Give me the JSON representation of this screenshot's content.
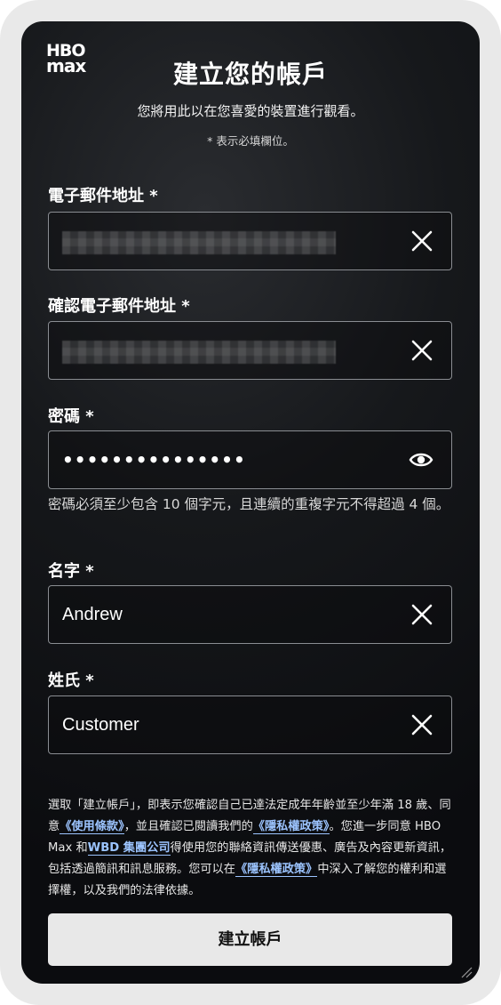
{
  "brand": {
    "logo_top": "HBO",
    "logo_bottom": "max"
  },
  "header": {
    "title": "建立您的帳戶",
    "subtitle": "您將用此以在您喜愛的裝置進行觀看。",
    "required_note": "* 表示必填欄位。"
  },
  "fields": {
    "email": {
      "label": "電子郵件地址 *",
      "value": "",
      "clear_icon": "close-icon"
    },
    "confirm_email": {
      "label": "確認電子郵件地址 *",
      "value": "",
      "clear_icon": "close-icon"
    },
    "password": {
      "label": "密碼 *",
      "value": "•••••••••••••••",
      "toggle_icon": "eye-icon",
      "hint": "密碼必須至少包含 10 個字元，且連續的重複字元不得超過 4 個。"
    },
    "first_name": {
      "label": "名字 *",
      "value": "Andrew",
      "clear_icon": "close-icon"
    },
    "last_name": {
      "label": "姓氏 *",
      "value": "Customer",
      "clear_icon": "close-icon"
    }
  },
  "legal": {
    "part1": "選取「建立帳戶」，即表示您確認自己已達法定成年年齡並至少年滿 18 歲、同意",
    "terms_link": "《使用條款》",
    "part2": "，並且確認已閱讀我們的",
    "privacy_link": "《隱私權政策》",
    "part3": "。您進一步同意 HBO Max 和",
    "wbd_link": "WBD 集團公司",
    "part4": "得使用您的聯絡資訊傳送優惠、廣告及內容更新資訊，包括透過簡訊和訊息服務。您可以在",
    "privacy_link_2": "《隱私權政策》",
    "part5": "中深入了解您的權利和選擇權，以及我們的法律依據。"
  },
  "submit": {
    "label": "建立帳戶"
  },
  "colors": {
    "link": "#9cc4ff",
    "button_bg": "#e8e8e8",
    "field_border": "#8a8d92"
  }
}
